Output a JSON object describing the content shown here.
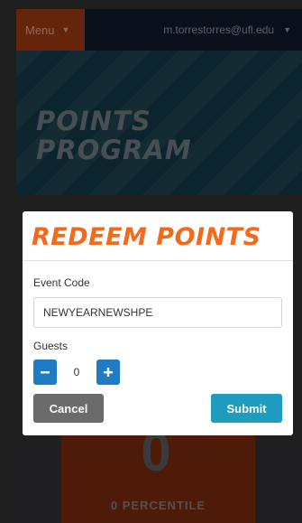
{
  "nav": {
    "menu_label": "Menu",
    "user_email": "m.torrestorres@ufl.edu"
  },
  "hero": {
    "title_line1": "POINTS",
    "title_line2": "PROGRAM"
  },
  "background_card": {
    "digit": "0",
    "label": "0 PERCENTILE"
  },
  "modal": {
    "title": "REDEEM POINTS",
    "event_code_label": "Event Code",
    "event_code_value": "NEWYEARNEWSHPE",
    "guests_label": "Guests",
    "guests_value": "0",
    "cancel_label": "Cancel",
    "submit_label": "Submit"
  },
  "colors": {
    "title_accent": "#f26b1d",
    "stepper_blue": "#1f7bc4",
    "submit_blue": "#1f9bc0",
    "cancel_gray": "#6b6b6b"
  }
}
